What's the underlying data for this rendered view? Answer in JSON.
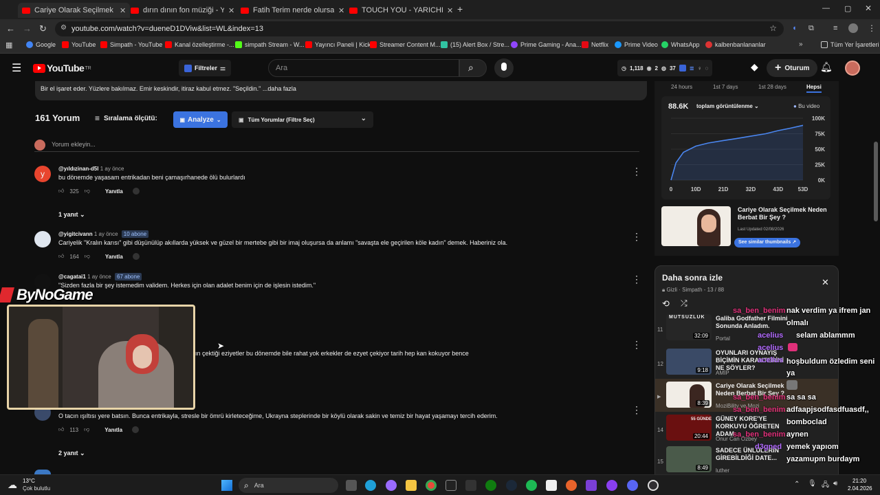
{
  "browser": {
    "tabs": [
      {
        "title": "Cariye Olarak Seçilmek Neden B"
      },
      {
        "title": "dırın dının fon müziği - YouTub"
      },
      {
        "title": "Fatih Terim nerde olursam olay"
      },
      {
        "title": "TOUCH YOU - YARICHIN B CLUB"
      }
    ],
    "url": "youtube.com/watch?v=dueneD1DViw&list=WL&index=13",
    "bookmarks": [
      "Google",
      "YouTube",
      "Simpath - YouTube",
      "Kanal özelleştirme -...",
      "simpath Stream - W...",
      "Yayıncı Paneli | Kick",
      "Streamer Content M...",
      "(15) Alert Box / Stre...",
      "Prime Gaming - Ana...",
      "Netflix",
      "Prime Video",
      "WhatsApp",
      "kalbenbanlananlar"
    ],
    "bookmarks_all": "Tüm Yer İşaretleri"
  },
  "header": {
    "logo": "YouTube",
    "logo_country": "TR",
    "filters": "Filtreler",
    "search_placeholder": "Ara",
    "stats": [
      "1,118",
      "2",
      "37"
    ],
    "login": "Oturum"
  },
  "description": "Bir el işaret eder. Yüzlere bakılmaz. Emir keskindir, itiraz kabul etmez. \"Seçildin.\" ...daha fazla",
  "comments_section": {
    "count": "161 Yorum",
    "sort_label": "Sıralama ölçütü:",
    "analyze": "Analyze",
    "filter": "Tüm Yorumlar (Filtre Seç)",
    "add_placeholder": "Yorum ekleyin...",
    "reply_label": "Yanıtla"
  },
  "comments": [
    {
      "author": "@yıldızinan-d5l",
      "time": "1 ay önce",
      "badge": "",
      "text": "bu dönemde yaşasam entrikadan beni çamaşırhanede ölü bulurlardı",
      "likes": "325",
      "replies": "1 yanıt"
    },
    {
      "author": "@yigitcivann",
      "time": "1 ay önce",
      "badge": "10 abone",
      "text": "Cariyelik \"Kralın karısı\" gibi düşünülüp akıllarda yüksek ve güzel bir mertebe gibi bir imaj oluşursa da anlamı \"savaşta ele geçirilen köle kadın\" demek. Haberiniz ola.",
      "likes": "164",
      "replies": ""
    },
    {
      "author": "@cagatai1",
      "time": "1 ay önce",
      "badge": "67 abone",
      "text": "\"Sizden fazla bir şey istemedim validem. Herkes için olan adalet benim için de işlesin istedim.\"",
      "likes": "",
      "replies": ""
    },
    {
      "author": "",
      "time": "",
      "badge": "",
      "text": "ın çektiği eziyetler bu dönemde bile rahat yok erkekler de ezyet çekiyor tarih hep kan kokuyor bence",
      "likes": "",
      "replies": ""
    },
    {
      "author": "",
      "time": "",
      "badge": "",
      "text": "O tacın ışıltısı yere batsın. Bunca entrikayla, stresle bir ömrü kirleteceğime, Ukrayna steplerinde bir köylü olarak sakin ve temiz bir hayat yaşamayı tercih ederim.",
      "likes": "113",
      "replies": "2 yanıt"
    }
  ],
  "analytics": {
    "tabs": [
      "24 hours",
      "1st 7 days",
      "1st 28 days",
      "Hepsi"
    ],
    "views": "88.6K",
    "metric_label": "toplam görüntülenme",
    "legend": "Bu video",
    "yticks": [
      "100K",
      "75K",
      "50K",
      "25K",
      "0K"
    ],
    "xticks": [
      "0",
      "10D",
      "21D",
      "32D",
      "43D",
      "53D"
    ],
    "card_title": "Cariye Olarak Seçilmek Neden Berbat Bir Şey ?",
    "card_updated": "Last Updated 02/08/2026",
    "card_button": "See similar thumbnails"
  },
  "chart_data": {
    "type": "area",
    "x": [
      0,
      2,
      5,
      10,
      15,
      21,
      26,
      32,
      38,
      43,
      48,
      53
    ],
    "values": [
      0,
      28000,
      45000,
      55000,
      60000,
      64000,
      67000,
      71000,
      75000,
      80000,
      84000,
      88600
    ],
    "ylim": [
      0,
      100000
    ],
    "xlabel": "",
    "ylabel": ""
  },
  "playlist": {
    "title": "Daha sonra izle",
    "subtitle": "Gizli · Simpath - 13 / 88",
    "items": [
      {
        "num": "11",
        "title": "Galiba Godfather Filmini Sonunda Anladım.",
        "channel": "Portal",
        "duration": "32:09",
        "thumb_text": "MUTSUZLUK"
      },
      {
        "num": "12",
        "title": "OYUNLARI OYNAYIŞ BİÇİMİN KARAKTERİNİ NE SÖYLER?",
        "channel": "AMİP",
        "duration": "9:18",
        "thumb_text": ""
      },
      {
        "num": "",
        "title": "Cariye Olarak Seçilmek Neden Berbat Bir Şey ?",
        "channel": "MoziBility ve Mozi",
        "duration": "8:39",
        "thumb_text": ""
      },
      {
        "num": "14",
        "title": "GÜNEY KORE'YE KORKUYU ÖĞRETEN ADAM",
        "channel": "Onur Can Özbey",
        "duration": "20:44",
        "thumb_text": "55 GÜNDE"
      },
      {
        "num": "15",
        "title": "SADECE ÜNLÜLERİN GİREBİLDİĞİ DATE...",
        "channel": "luther",
        "duration": "8:49",
        "thumb_text": ""
      }
    ]
  },
  "overlay": {
    "brand": "ByNoGame",
    "chat": [
      {
        "name": "sa_ben_benim",
        "msg": "nak verdim ya ifrem jan",
        "color": "#e0307a"
      },
      {
        "name": "",
        "msg": "olmalı",
        "color": ""
      },
      {
        "name": "acelius",
        "msg": "selam ablammm",
        "color": "#b36bff"
      },
      {
        "name": "acelius",
        "msg": "hoşbuldum özledim seni ya",
        "color": "#b36bff"
      },
      {
        "name": "acelius",
        "msg": "",
        "color": "#b36bff"
      },
      {
        "name": "sa_ben_benim",
        "msg": "sa sa sa",
        "color": "#e0307a"
      },
      {
        "name": "sa_ben_benim",
        "msg": "adfaapjsodfasdfuasdf,,",
        "color": "#e0307a"
      },
      {
        "name": "",
        "msg": "bomboclad",
        "color": ""
      },
      {
        "name": "sa_ben_benim",
        "msg": "aynen",
        "color": "#e0307a"
      },
      {
        "name": "d3gned",
        "msg": "yemek yapıom",
        "color": "#b36bff"
      },
      {
        "name": "",
        "msg": "yazamupm burdaym",
        "color": ""
      }
    ]
  },
  "taskbar": {
    "weather_temp": "13°C",
    "weather_desc": "Çok bulutlu",
    "search": "Ara",
    "time": "21:20",
    "date": "2.04.2026"
  }
}
